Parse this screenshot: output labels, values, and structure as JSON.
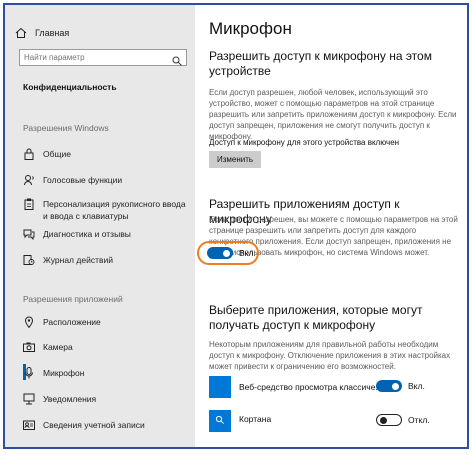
{
  "sidebar": {
    "home_label": "Главная",
    "search_placeholder": "Найти параметр",
    "section_title": "Конфиденциальность",
    "group1_title": "Разрешения Windows",
    "group1_items": [
      {
        "label": "Общие",
        "icon": "lock-icon"
      },
      {
        "label": "Голосовые функции",
        "icon": "speech-icon"
      },
      {
        "label": "Персонализация рукописного ввода и ввода с клавиатуры",
        "icon": "clipboard-icon"
      },
      {
        "label": "Диагностика и отзывы",
        "icon": "feedback-icon"
      },
      {
        "label": "Журнал действий",
        "icon": "history-icon"
      }
    ],
    "group2_title": "Разрешения приложений",
    "group2_items": [
      {
        "label": "Расположение",
        "icon": "location-icon"
      },
      {
        "label": "Камера",
        "icon": "camera-icon"
      },
      {
        "label": "Микрофон",
        "icon": "microphone-icon",
        "active": true
      },
      {
        "label": "Уведомления",
        "icon": "notification-icon"
      },
      {
        "label": "Сведения учетной записи",
        "icon": "account-icon"
      }
    ]
  },
  "main": {
    "title": "Микрофон",
    "device_section": {
      "heading": "Разрешить доступ к микрофону на этом устройстве",
      "description": "Если доступ разрешен, любой человек, использующий это устройство, может с помощью параметров на этой странице разрешить или запретить приложениям доступ к микрофону. Если доступ запрещен, приложения не смогут получить доступ к микрофону.",
      "status": "Доступ к микрофону для этого устройства включен",
      "button": "Изменить"
    },
    "apps_section": {
      "heading": "Разрешить приложениям доступ к микрофону",
      "description": "Если доступ разрешен, вы можете с помощью параметров на этой странице разрешить или запретить доступ для каждого конкретного приложения. Если доступ запрещен, приложения не могут использовать микрофон, но система Windows может.",
      "toggle_label": "Вкл.",
      "toggle_on": true
    },
    "choose_section": {
      "heading": "Выберите приложения, которые могут получать доступ к микрофону",
      "description": "Некоторым приложениям для правильной работы необходим доступ к микрофону. Отключение приложения в этих настройках может привести к ограничению его возможностей.",
      "apps": [
        {
          "name": "Веб-средство просмотра классиче...",
          "toggle_label": "Вкл.",
          "on": true,
          "icon": "web-viewer-icon"
        },
        {
          "name": "Кортана",
          "toggle_label": "Откл.",
          "on": false,
          "icon": "search-icon"
        }
      ]
    }
  },
  "colors": {
    "accent": "#0063b1",
    "highlight_ring": "#f07d1a",
    "frame_border": "#2d4fa0",
    "sidebar_bg": "#e8e8e8"
  }
}
